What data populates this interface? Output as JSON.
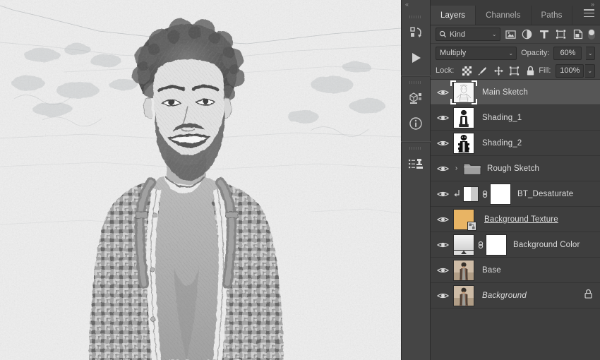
{
  "window": {
    "collapse_left_arrow": "«",
    "expand_right_arrow": "»"
  },
  "icon_dock": {
    "groups": [
      {
        "items": [
          {
            "name": "actions-icon",
            "title": "Actions"
          },
          {
            "name": "play-icon",
            "title": "Play"
          }
        ]
      },
      {
        "items": [
          {
            "name": "3d-icon",
            "title": "3D"
          },
          {
            "name": "info-icon",
            "title": "Info"
          }
        ]
      },
      {
        "items": [
          {
            "name": "clone-source-icon",
            "title": "Clone Source"
          }
        ]
      }
    ]
  },
  "panel": {
    "tabs": [
      {
        "label": "Layers",
        "active": true
      },
      {
        "label": "Channels",
        "active": false
      },
      {
        "label": "Paths",
        "active": false
      }
    ],
    "menu_icon": "hamburger-menu-icon",
    "filter": {
      "kind_label": "Kind",
      "search_icon": "search-icon",
      "chevron": "⌄",
      "type_icons": [
        "pixel-layer-filter-icon",
        "adjustment-layer-filter-icon",
        "type-layer-filter-icon",
        "shape-layer-filter-icon",
        "smart-object-filter-icon"
      ],
      "toggle_name": "filter-enable-toggle"
    },
    "blend": {
      "mode": "Multiply",
      "opacity_label": "Opacity:",
      "opacity_value": "60%",
      "chevron": "⌄"
    },
    "lock": {
      "label": "Lock:",
      "icons": [
        "lock-transparent-pixels-icon",
        "lock-image-pixels-icon",
        "lock-position-icon",
        "lock-artboard-nesting-icon",
        "lock-all-icon"
      ],
      "fill_label": "Fill:",
      "fill_value": "100%"
    },
    "layers": [
      {
        "name": "Main Sketch",
        "type": "pixel",
        "selected": true,
        "visible": true,
        "thumb": "sketch-head",
        "locked": false,
        "editing": false,
        "italic": false
      },
      {
        "name": "Shading_1",
        "type": "pixel",
        "selected": false,
        "visible": true,
        "thumb": "sketch-figure-light",
        "locked": false,
        "editing": false,
        "italic": false
      },
      {
        "name": "Shading_2",
        "type": "pixel",
        "selected": false,
        "visible": true,
        "thumb": "sketch-figure-dark",
        "locked": false,
        "editing": false,
        "italic": false
      },
      {
        "name": "Rough Sketch",
        "type": "group",
        "selected": false,
        "visible": true,
        "thumb": "folder",
        "locked": false,
        "editing": false,
        "italic": false
      },
      {
        "name": "BT_Desaturate",
        "type": "adjustment",
        "selected": false,
        "visible": true,
        "thumb": "half-black-white",
        "clipped": true,
        "masked": true,
        "locked": false,
        "editing": false,
        "italic": false
      },
      {
        "name": "Background Texture",
        "type": "smart-object",
        "selected": false,
        "visible": true,
        "thumb": "orange-texture",
        "locked": false,
        "editing": true,
        "italic": false
      },
      {
        "name": "Background Color",
        "type": "adjustment",
        "selected": false,
        "visible": true,
        "thumb": "gradient-map",
        "masked": true,
        "locked": false,
        "editing": false,
        "italic": false
      },
      {
        "name": "Base",
        "type": "pixel",
        "selected": false,
        "visible": true,
        "thumb": "photo",
        "locked": false,
        "editing": false,
        "italic": false
      },
      {
        "name": "Background",
        "type": "pixel",
        "selected": false,
        "visible": true,
        "thumb": "photo",
        "locked": true,
        "editing": false,
        "italic": true
      }
    ]
  },
  "canvas": {
    "document_description": "Pencil sketch effect portrait of a smiling man with curly hair, beard, plaid shirt and backpack on a light background"
  },
  "colors": {
    "panel_bg": "#454545",
    "layers_bg": "#3e3e3e",
    "selected_row": "#565656",
    "tabbar_bg": "#3b3b3b",
    "text": "#dcdcdc",
    "texture_thumb": "#e8b464",
    "canvas_bg": "#f0f0f0"
  }
}
